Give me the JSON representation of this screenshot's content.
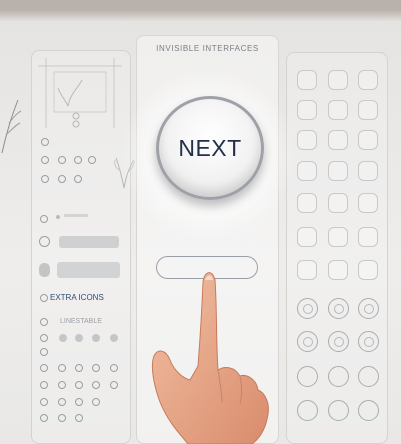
{
  "header": {
    "title": "INVISIBLE INTERFACES"
  },
  "primary_button": {
    "label": "NEXT"
  },
  "left_panel": {
    "section_label": "EXTRA ICONS",
    "faded_label": "LINESTABLE"
  },
  "colors": {
    "button_text": "#24304a",
    "label_blue": "#2e4d7a",
    "skin": "#e9a98b"
  }
}
